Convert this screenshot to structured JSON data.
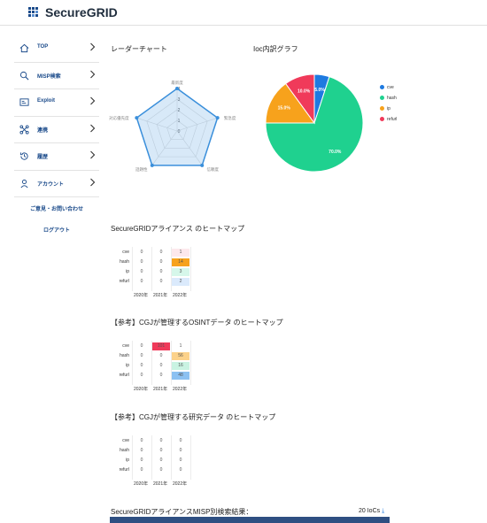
{
  "header": {
    "logo": "SecureGRID"
  },
  "sidebar": {
    "items": [
      {
        "label": "TOP",
        "icon": "home-icon"
      },
      {
        "label": "MISP検索",
        "icon": "search-icon"
      },
      {
        "label": "Exploit",
        "icon": "exploit-icon"
      },
      {
        "label": "連携",
        "icon": "link-icon"
      },
      {
        "label": "履歴",
        "icon": "history-icon"
      },
      {
        "label": "アカウント",
        "icon": "user-icon"
      }
    ],
    "contact": "ご意見・お問い合わせ",
    "logout": "ログアウト"
  },
  "radar": {
    "title": "レーダーチャート",
    "axes": [
      "最新度",
      "緊急度",
      "信頼度",
      "話題性",
      "対応優先度"
    ],
    "ticks": [
      "4",
      "3",
      "2",
      "1",
      "0"
    ],
    "values": [
      4,
      4,
      4,
      4,
      4
    ],
    "color": "#3a8fdb"
  },
  "pie": {
    "title": "Ioc内訳グラフ",
    "slices": [
      {
        "name": "cve",
        "value": 5.0,
        "label": "5.0%",
        "color": "#1e7ae0"
      },
      {
        "name": "hash",
        "value": 70.0,
        "label": "70.0%",
        "color": "#1fd18f"
      },
      {
        "name": "ip",
        "value": 15.0,
        "label": "15.0%",
        "color": "#f7a21c"
      },
      {
        "name": "refurl",
        "value": 10.0,
        "label": "10.0%",
        "color": "#f03a5a"
      }
    ]
  },
  "heatmaps": [
    {
      "title": "SecureGRIDアライアンス のヒートマップ",
      "rows": [
        "cve",
        "hash",
        "ip",
        "refurl"
      ],
      "cols": [
        "2020年",
        "2021年",
        "2022年"
      ],
      "cells": [
        [
          "0",
          "0",
          "1"
        ],
        [
          "0",
          "0",
          "14"
        ],
        [
          "0",
          "0",
          "3"
        ],
        [
          "0",
          "0",
          "2"
        ]
      ],
      "colors": [
        [
          "#fff",
          "#fff",
          "#fde8ec"
        ],
        [
          "#fff",
          "#fff",
          "#f7a21c"
        ],
        [
          "#fff",
          "#fff",
          "#d6f7ea"
        ],
        [
          "#fff",
          "#fff",
          "#dbeafc"
        ]
      ]
    },
    {
      "title": "【参考】CGJが管理するOSINTデータ のヒートマップ",
      "rows": [
        "cve",
        "hash",
        "ip",
        "refurl"
      ],
      "cols": [
        "2020年",
        "2021年",
        "2022年"
      ],
      "cells": [
        [
          "0",
          "101",
          "1"
        ],
        [
          "0",
          "0",
          "56"
        ],
        [
          "0",
          "0",
          "16"
        ],
        [
          "0",
          "0",
          "48"
        ]
      ],
      "colors": [
        [
          "#fff",
          "#f03a5a",
          "#fff"
        ],
        [
          "#fff",
          "#fff",
          "#fcd28a"
        ],
        [
          "#fff",
          "#fff",
          "#c9f3e2"
        ],
        [
          "#fff",
          "#fff",
          "#8cc1f2"
        ]
      ]
    },
    {
      "title": "【参考】CGJが管理する研究データ のヒートマップ",
      "rows": [
        "cve",
        "hash",
        "ip",
        "refurl"
      ],
      "cols": [
        "2020年",
        "2021年",
        "2022年"
      ],
      "cells": [
        [
          "0",
          "0",
          "0"
        ],
        [
          "0",
          "0",
          "0"
        ],
        [
          "0",
          "0",
          "0"
        ],
        [
          "0",
          "0",
          "0"
        ]
      ],
      "colors": [
        [
          "#fff",
          "#fff",
          "#fff"
        ],
        [
          "#fff",
          "#fff",
          "#fff"
        ],
        [
          "#fff",
          "#fff",
          "#fff"
        ],
        [
          "#fff",
          "#fff",
          "#fff"
        ]
      ]
    }
  ],
  "results": {
    "title": "SecureGRIDアライアンスMISP別検索結果：",
    "count": "20 IoCs"
  }
}
